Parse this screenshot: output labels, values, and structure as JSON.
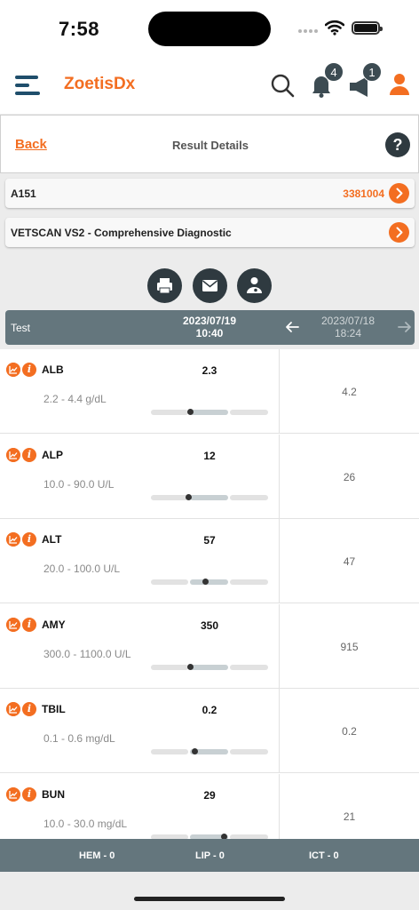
{
  "status_bar": {
    "time": "7:58"
  },
  "header": {
    "brand": "ZoetisDx",
    "notification_count": "4",
    "announcement_count": "1",
    "icons": [
      "menu-icon",
      "search-icon",
      "bell-icon",
      "megaphone-icon",
      "user-icon"
    ]
  },
  "details_bar": {
    "back_label": "Back",
    "title": "Result Details",
    "help_label": "?"
  },
  "sample": {
    "id": "A151",
    "number": "3381004"
  },
  "test": {
    "name": "VETSCAN VS2 - Comprehensive Diagnostic"
  },
  "actions": [
    "print-icon",
    "email-icon",
    "share-icon"
  ],
  "results_header": {
    "col_label": "Test",
    "current_date": "2023/07/19",
    "current_time": "10:40",
    "previous_date": "2023/07/18",
    "previous_time": "18:24"
  },
  "results": [
    {
      "name": "ALB",
      "value": "2.3",
      "range": "2.2 - 4.4 g/dL",
      "previous": "4.2",
      "marker": 0.33
    },
    {
      "name": "ALP",
      "value": "12",
      "range": "10.0 - 90.0 U/L",
      "previous": "26",
      "marker": 0.32
    },
    {
      "name": "ALT",
      "value": "57",
      "range": "20.0 - 100.0 U/L",
      "previous": "47",
      "marker": 0.46
    },
    {
      "name": "AMY",
      "value": "350",
      "range": "300.0 - 1100.0 U/L",
      "previous": "915",
      "marker": 0.33
    },
    {
      "name": "TBIL",
      "value": "0.2",
      "range": "0.1 - 0.6 mg/dL",
      "previous": "0.2",
      "marker": 0.37
    },
    {
      "name": "BUN",
      "value": "29",
      "range": "10.0 - 30.0 mg/dL",
      "previous": "21",
      "marker": 0.62
    }
  ],
  "footer": {
    "hem": "HEM - 0",
    "lip": "LIP - 0",
    "ict": "ICT - 0"
  },
  "colors": {
    "accent": "#f36e21",
    "header_band": "#64767d",
    "dark_button": "#2f3a40",
    "navy": "#1f4e6b"
  }
}
